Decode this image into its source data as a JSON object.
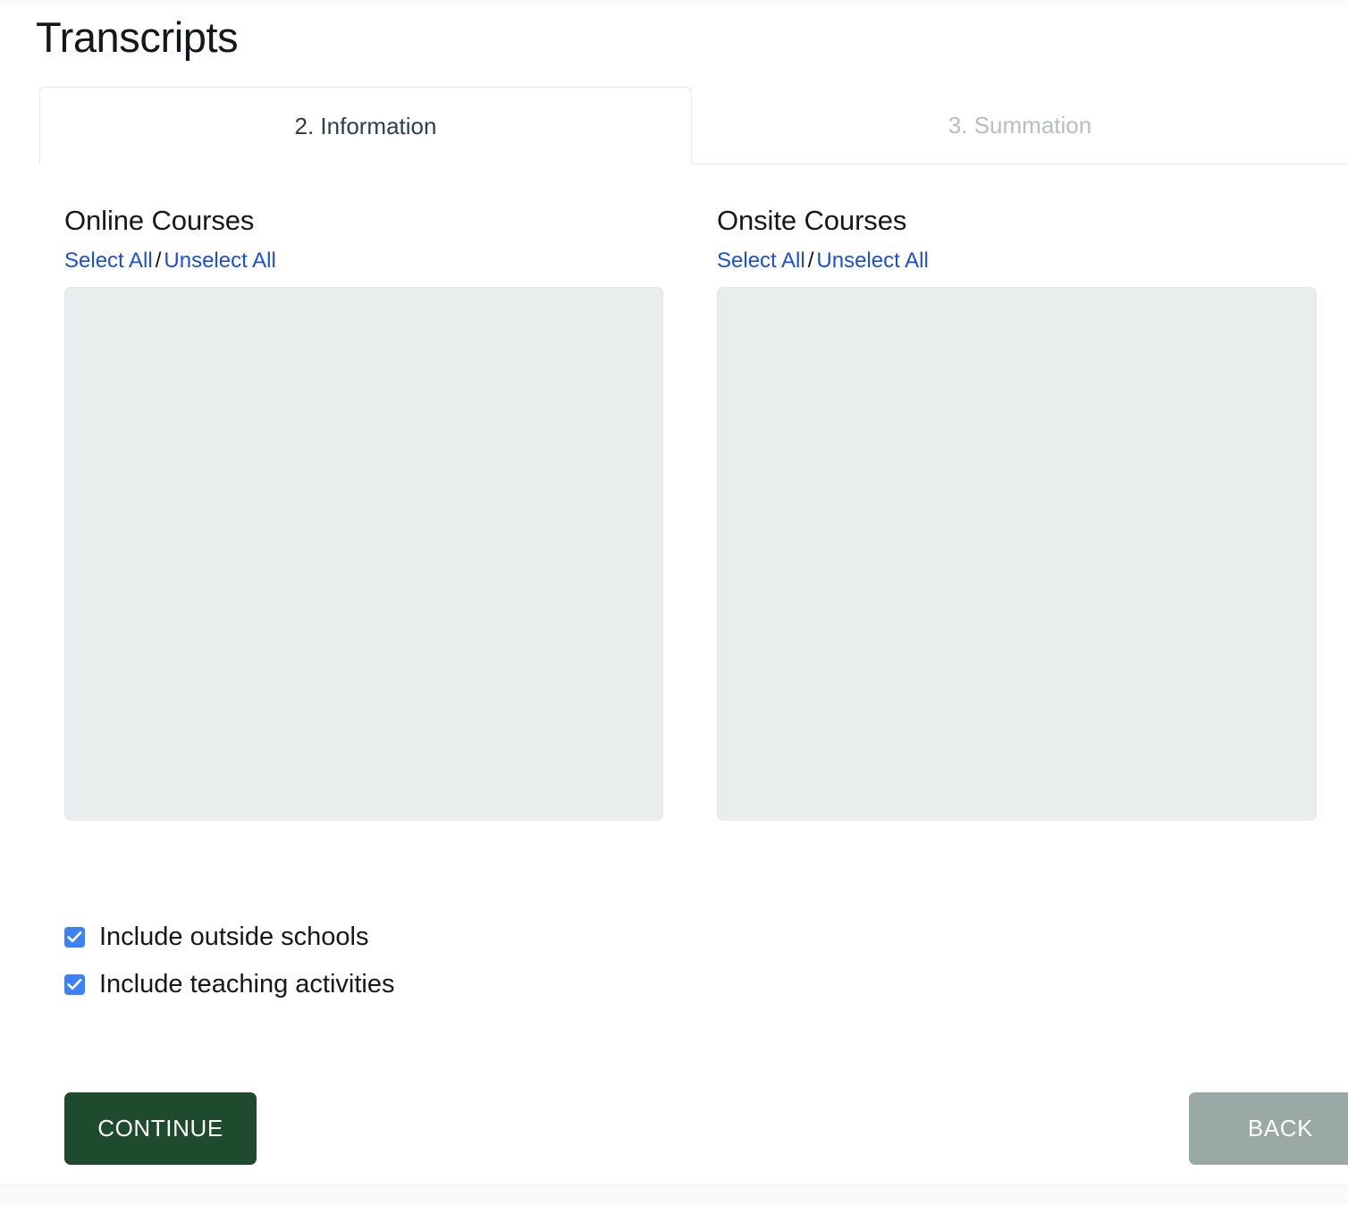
{
  "page": {
    "title": "Transcripts"
  },
  "tabs": [
    {
      "label": "2. Information",
      "active": true,
      "name": "tab-information"
    },
    {
      "label": "3. Summation",
      "active": false,
      "name": "tab-summation"
    }
  ],
  "columns": [
    {
      "heading": "Online Courses",
      "select_all": "Select All",
      "separator": "/",
      "unselect_all": "Unselect All",
      "listbox_items": []
    },
    {
      "heading": "Onsite Courses",
      "select_all": "Select All",
      "separator": "/",
      "unselect_all": "Unselect All",
      "listbox_items": []
    }
  ],
  "checkboxes": [
    {
      "label": "Include outside schools",
      "checked": true
    },
    {
      "label": "Include teaching activities",
      "checked": true
    }
  ],
  "buttons": {
    "continue_label": "CONTINUE",
    "back_label": "BACK"
  },
  "colors": {
    "accent_link": "#1a4fd6",
    "checkbox": "#3b82f6",
    "continue_bg": "#1e4a2e",
    "back_bg": "#9aa8a6",
    "active_tab_text": "#2f3e4d",
    "inactive_tab_text": "#b6bec4",
    "listbox_bg": "#e9edee"
  }
}
